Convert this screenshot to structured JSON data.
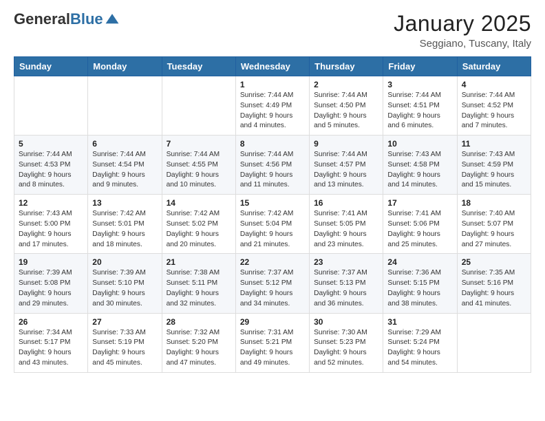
{
  "logo": {
    "general": "General",
    "blue": "Blue"
  },
  "header": {
    "title": "January 2025",
    "subtitle": "Seggiano, Tuscany, Italy"
  },
  "weekdays": [
    "Sunday",
    "Monday",
    "Tuesday",
    "Wednesday",
    "Thursday",
    "Friday",
    "Saturday"
  ],
  "weeks": [
    [
      {
        "day": "",
        "info": ""
      },
      {
        "day": "",
        "info": ""
      },
      {
        "day": "",
        "info": ""
      },
      {
        "day": "1",
        "info": "Sunrise: 7:44 AM\nSunset: 4:49 PM\nDaylight: 9 hours\nand 4 minutes."
      },
      {
        "day": "2",
        "info": "Sunrise: 7:44 AM\nSunset: 4:50 PM\nDaylight: 9 hours\nand 5 minutes."
      },
      {
        "day": "3",
        "info": "Sunrise: 7:44 AM\nSunset: 4:51 PM\nDaylight: 9 hours\nand 6 minutes."
      },
      {
        "day": "4",
        "info": "Sunrise: 7:44 AM\nSunset: 4:52 PM\nDaylight: 9 hours\nand 7 minutes."
      }
    ],
    [
      {
        "day": "5",
        "info": "Sunrise: 7:44 AM\nSunset: 4:53 PM\nDaylight: 9 hours\nand 8 minutes."
      },
      {
        "day": "6",
        "info": "Sunrise: 7:44 AM\nSunset: 4:54 PM\nDaylight: 9 hours\nand 9 minutes."
      },
      {
        "day": "7",
        "info": "Sunrise: 7:44 AM\nSunset: 4:55 PM\nDaylight: 9 hours\nand 10 minutes."
      },
      {
        "day": "8",
        "info": "Sunrise: 7:44 AM\nSunset: 4:56 PM\nDaylight: 9 hours\nand 11 minutes."
      },
      {
        "day": "9",
        "info": "Sunrise: 7:44 AM\nSunset: 4:57 PM\nDaylight: 9 hours\nand 13 minutes."
      },
      {
        "day": "10",
        "info": "Sunrise: 7:43 AM\nSunset: 4:58 PM\nDaylight: 9 hours\nand 14 minutes."
      },
      {
        "day": "11",
        "info": "Sunrise: 7:43 AM\nSunset: 4:59 PM\nDaylight: 9 hours\nand 15 minutes."
      }
    ],
    [
      {
        "day": "12",
        "info": "Sunrise: 7:43 AM\nSunset: 5:00 PM\nDaylight: 9 hours\nand 17 minutes."
      },
      {
        "day": "13",
        "info": "Sunrise: 7:42 AM\nSunset: 5:01 PM\nDaylight: 9 hours\nand 18 minutes."
      },
      {
        "day": "14",
        "info": "Sunrise: 7:42 AM\nSunset: 5:02 PM\nDaylight: 9 hours\nand 20 minutes."
      },
      {
        "day": "15",
        "info": "Sunrise: 7:42 AM\nSunset: 5:04 PM\nDaylight: 9 hours\nand 21 minutes."
      },
      {
        "day": "16",
        "info": "Sunrise: 7:41 AM\nSunset: 5:05 PM\nDaylight: 9 hours\nand 23 minutes."
      },
      {
        "day": "17",
        "info": "Sunrise: 7:41 AM\nSunset: 5:06 PM\nDaylight: 9 hours\nand 25 minutes."
      },
      {
        "day": "18",
        "info": "Sunrise: 7:40 AM\nSunset: 5:07 PM\nDaylight: 9 hours\nand 27 minutes."
      }
    ],
    [
      {
        "day": "19",
        "info": "Sunrise: 7:39 AM\nSunset: 5:08 PM\nDaylight: 9 hours\nand 29 minutes."
      },
      {
        "day": "20",
        "info": "Sunrise: 7:39 AM\nSunset: 5:10 PM\nDaylight: 9 hours\nand 30 minutes."
      },
      {
        "day": "21",
        "info": "Sunrise: 7:38 AM\nSunset: 5:11 PM\nDaylight: 9 hours\nand 32 minutes."
      },
      {
        "day": "22",
        "info": "Sunrise: 7:37 AM\nSunset: 5:12 PM\nDaylight: 9 hours\nand 34 minutes."
      },
      {
        "day": "23",
        "info": "Sunrise: 7:37 AM\nSunset: 5:13 PM\nDaylight: 9 hours\nand 36 minutes."
      },
      {
        "day": "24",
        "info": "Sunrise: 7:36 AM\nSunset: 5:15 PM\nDaylight: 9 hours\nand 38 minutes."
      },
      {
        "day": "25",
        "info": "Sunrise: 7:35 AM\nSunset: 5:16 PM\nDaylight: 9 hours\nand 41 minutes."
      }
    ],
    [
      {
        "day": "26",
        "info": "Sunrise: 7:34 AM\nSunset: 5:17 PM\nDaylight: 9 hours\nand 43 minutes."
      },
      {
        "day": "27",
        "info": "Sunrise: 7:33 AM\nSunset: 5:19 PM\nDaylight: 9 hours\nand 45 minutes."
      },
      {
        "day": "28",
        "info": "Sunrise: 7:32 AM\nSunset: 5:20 PM\nDaylight: 9 hours\nand 47 minutes."
      },
      {
        "day": "29",
        "info": "Sunrise: 7:31 AM\nSunset: 5:21 PM\nDaylight: 9 hours\nand 49 minutes."
      },
      {
        "day": "30",
        "info": "Sunrise: 7:30 AM\nSunset: 5:23 PM\nDaylight: 9 hours\nand 52 minutes."
      },
      {
        "day": "31",
        "info": "Sunrise: 7:29 AM\nSunset: 5:24 PM\nDaylight: 9 hours\nand 54 minutes."
      },
      {
        "day": "",
        "info": ""
      }
    ]
  ]
}
